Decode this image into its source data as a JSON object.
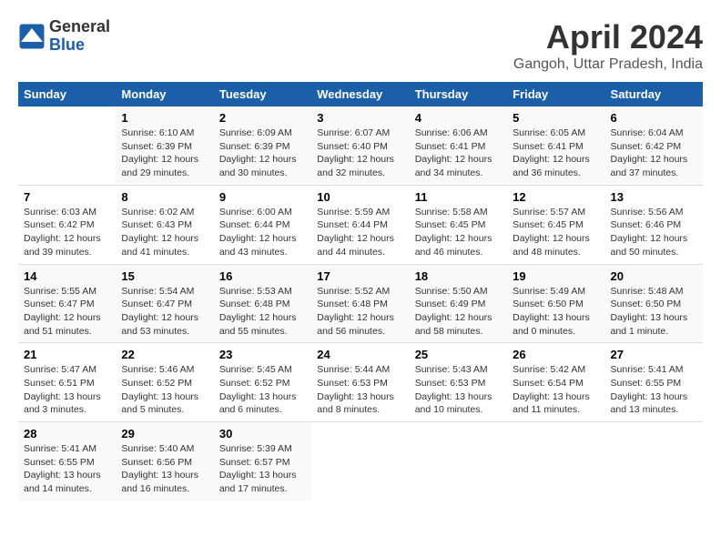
{
  "header": {
    "logo_line1": "General",
    "logo_line2": "Blue",
    "month_title": "April 2024",
    "location": "Gangoh, Uttar Pradesh, India"
  },
  "days_of_week": [
    "Sunday",
    "Monday",
    "Tuesday",
    "Wednesday",
    "Thursday",
    "Friday",
    "Saturday"
  ],
  "weeks": [
    [
      {
        "day": "",
        "info": ""
      },
      {
        "day": "1",
        "info": "Sunrise: 6:10 AM\nSunset: 6:39 PM\nDaylight: 12 hours\nand 29 minutes."
      },
      {
        "day": "2",
        "info": "Sunrise: 6:09 AM\nSunset: 6:39 PM\nDaylight: 12 hours\nand 30 minutes."
      },
      {
        "day": "3",
        "info": "Sunrise: 6:07 AM\nSunset: 6:40 PM\nDaylight: 12 hours\nand 32 minutes."
      },
      {
        "day": "4",
        "info": "Sunrise: 6:06 AM\nSunset: 6:41 PM\nDaylight: 12 hours\nand 34 minutes."
      },
      {
        "day": "5",
        "info": "Sunrise: 6:05 AM\nSunset: 6:41 PM\nDaylight: 12 hours\nand 36 minutes."
      },
      {
        "day": "6",
        "info": "Sunrise: 6:04 AM\nSunset: 6:42 PM\nDaylight: 12 hours\nand 37 minutes."
      }
    ],
    [
      {
        "day": "7",
        "info": "Sunrise: 6:03 AM\nSunset: 6:42 PM\nDaylight: 12 hours\nand 39 minutes."
      },
      {
        "day": "8",
        "info": "Sunrise: 6:02 AM\nSunset: 6:43 PM\nDaylight: 12 hours\nand 41 minutes."
      },
      {
        "day": "9",
        "info": "Sunrise: 6:00 AM\nSunset: 6:44 PM\nDaylight: 12 hours\nand 43 minutes."
      },
      {
        "day": "10",
        "info": "Sunrise: 5:59 AM\nSunset: 6:44 PM\nDaylight: 12 hours\nand 44 minutes."
      },
      {
        "day": "11",
        "info": "Sunrise: 5:58 AM\nSunset: 6:45 PM\nDaylight: 12 hours\nand 46 minutes."
      },
      {
        "day": "12",
        "info": "Sunrise: 5:57 AM\nSunset: 6:45 PM\nDaylight: 12 hours\nand 48 minutes."
      },
      {
        "day": "13",
        "info": "Sunrise: 5:56 AM\nSunset: 6:46 PM\nDaylight: 12 hours\nand 50 minutes."
      }
    ],
    [
      {
        "day": "14",
        "info": "Sunrise: 5:55 AM\nSunset: 6:47 PM\nDaylight: 12 hours\nand 51 minutes."
      },
      {
        "day": "15",
        "info": "Sunrise: 5:54 AM\nSunset: 6:47 PM\nDaylight: 12 hours\nand 53 minutes."
      },
      {
        "day": "16",
        "info": "Sunrise: 5:53 AM\nSunset: 6:48 PM\nDaylight: 12 hours\nand 55 minutes."
      },
      {
        "day": "17",
        "info": "Sunrise: 5:52 AM\nSunset: 6:48 PM\nDaylight: 12 hours\nand 56 minutes."
      },
      {
        "day": "18",
        "info": "Sunrise: 5:50 AM\nSunset: 6:49 PM\nDaylight: 12 hours\nand 58 minutes."
      },
      {
        "day": "19",
        "info": "Sunrise: 5:49 AM\nSunset: 6:50 PM\nDaylight: 13 hours\nand 0 minutes."
      },
      {
        "day": "20",
        "info": "Sunrise: 5:48 AM\nSunset: 6:50 PM\nDaylight: 13 hours\nand 1 minute."
      }
    ],
    [
      {
        "day": "21",
        "info": "Sunrise: 5:47 AM\nSunset: 6:51 PM\nDaylight: 13 hours\nand 3 minutes."
      },
      {
        "day": "22",
        "info": "Sunrise: 5:46 AM\nSunset: 6:52 PM\nDaylight: 13 hours\nand 5 minutes."
      },
      {
        "day": "23",
        "info": "Sunrise: 5:45 AM\nSunset: 6:52 PM\nDaylight: 13 hours\nand 6 minutes."
      },
      {
        "day": "24",
        "info": "Sunrise: 5:44 AM\nSunset: 6:53 PM\nDaylight: 13 hours\nand 8 minutes."
      },
      {
        "day": "25",
        "info": "Sunrise: 5:43 AM\nSunset: 6:53 PM\nDaylight: 13 hours\nand 10 minutes."
      },
      {
        "day": "26",
        "info": "Sunrise: 5:42 AM\nSunset: 6:54 PM\nDaylight: 13 hours\nand 11 minutes."
      },
      {
        "day": "27",
        "info": "Sunrise: 5:41 AM\nSunset: 6:55 PM\nDaylight: 13 hours\nand 13 minutes."
      }
    ],
    [
      {
        "day": "28",
        "info": "Sunrise: 5:41 AM\nSunset: 6:55 PM\nDaylight: 13 hours\nand 14 minutes."
      },
      {
        "day": "29",
        "info": "Sunrise: 5:40 AM\nSunset: 6:56 PM\nDaylight: 13 hours\nand 16 minutes."
      },
      {
        "day": "30",
        "info": "Sunrise: 5:39 AM\nSunset: 6:57 PM\nDaylight: 13 hours\nand 17 minutes."
      },
      {
        "day": "",
        "info": ""
      },
      {
        "day": "",
        "info": ""
      },
      {
        "day": "",
        "info": ""
      },
      {
        "day": "",
        "info": ""
      }
    ]
  ]
}
